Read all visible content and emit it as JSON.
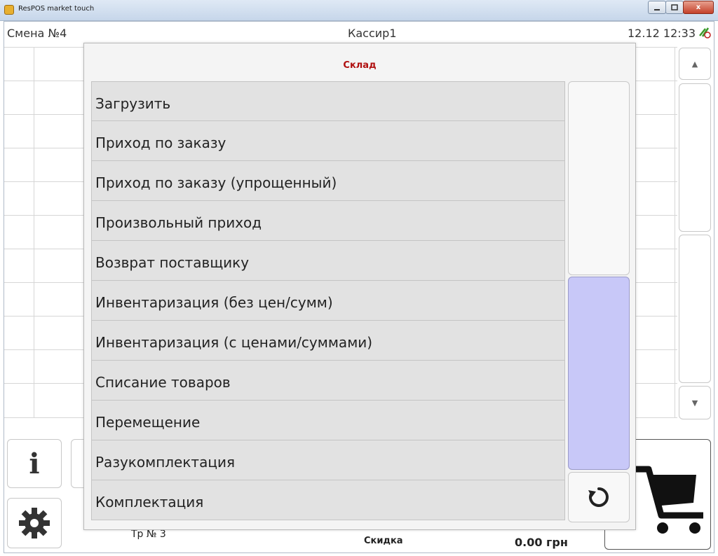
{
  "window": {
    "title": "ResPOS market touch",
    "minimize_icon": "minimize-icon",
    "maximize_icon": "maximize-icon",
    "close_label": "x"
  },
  "header": {
    "shift": "Смена №4",
    "cashier": "Кассир1",
    "datetime": "12.12 12:33",
    "status_icon": "connection-status-icon"
  },
  "footer": {
    "receipt": "Тр № 3",
    "discount_label": "Скидка",
    "total": "0.00 грн"
  },
  "icons": {
    "info": "i",
    "settings": "gear-icon",
    "cart": "cart-icon",
    "refresh": "refresh-icon",
    "scroll_up": "▲",
    "scroll_down": "▼"
  },
  "modal": {
    "title": "Склад",
    "items": [
      {
        "label": "Загрузить"
      },
      {
        "label": "Приход по заказу"
      },
      {
        "label": "Приход по заказу (упрощенный)"
      },
      {
        "label": "Произвольный приход"
      },
      {
        "label": "Возврат поставщику"
      },
      {
        "label": "Инвентаризация (без цен/сумм)"
      },
      {
        "label": "Инвентаризация (с ценами/суммами)"
      },
      {
        "label": "Списание товаров"
      },
      {
        "label": "Перемещение"
      },
      {
        "label": "Разукомплектация"
      },
      {
        "label": "Комплектация"
      }
    ]
  },
  "colors": {
    "modal_title": "#b01010",
    "scroll_thumb": "#c8c8f8",
    "menu_item_bg": "#e2e2e2"
  }
}
